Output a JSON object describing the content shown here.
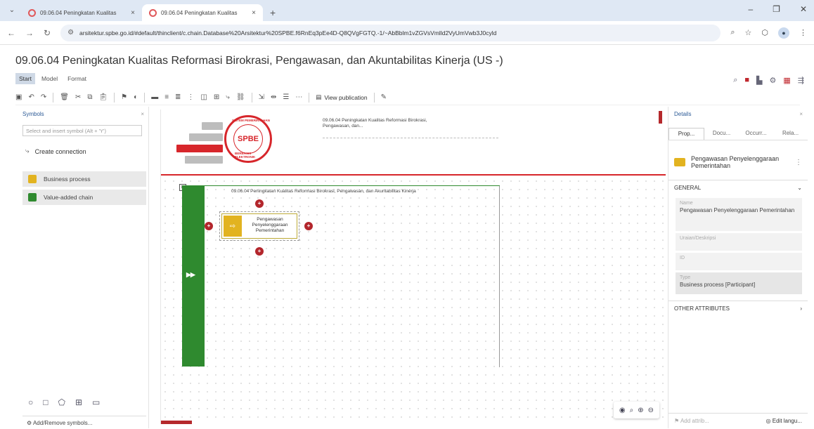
{
  "browser": {
    "tabs": [
      {
        "title": "09.06.04 Peningkatan Kualitas",
        "active": false
      },
      {
        "title": "09.06.04 Peningkatan Kualitas",
        "active": true
      }
    ],
    "url": "arsitektur.spbe.go.id/#default/thinclient/c.chain.Database%20Arsitektur%20SPBE.f6RnEq3pEe4D-Q8QVgFGTQ.-1/~AbBblm1vZGVsVmlld2VyUmVwb3J0cyld"
  },
  "app": {
    "title": "09.06.04 Peningkatan Kualitas Reformasi Birokrasi, Pengawasan, dan Akuntabilitas Kinerja  (US -)",
    "menu_tabs": [
      "Start",
      "Model",
      "Format"
    ],
    "toolbar_view_publication": "View publication"
  },
  "symbols_panel": {
    "title": "Symbols",
    "search_placeholder": "Select and insert symbol (Alt + 'Y')",
    "create_connection": "Create connection",
    "items": [
      {
        "label": "Business process",
        "color": "#e2b320"
      },
      {
        "label": "Value-added chain",
        "color": "#2f8a2f"
      }
    ],
    "add_remove": "Add/Remove symbols..."
  },
  "canvas": {
    "header_title": "09.06.04 Peningkatan Kualitas Reformasi Birokrasi, Pengawasan, dan...",
    "vac_title": "09.06.04 Peningkatan Kualitas Reformasi Birokrasi, Pengawasan, dan Akuntabilitas Kinerja",
    "process_label": "Pengawasan Penyelenggaraan Pemerintahan",
    "logo_text": "SPBE",
    "logo_seal_top": "SISTEM PEMERINTAHAN",
    "logo_seal_bottom": "BERBASIS ELEKTRONIK",
    "bar_colors": [
      "#bdbdbd",
      "#bdbdbd",
      "#d7262b",
      "#bdbdbd"
    ]
  },
  "details_panel": {
    "title": "Details",
    "tabs": [
      "Prop...",
      "Docu...",
      "Occurr...",
      "Rela..."
    ],
    "object_name": "Pengawasan Penyelenggaraan Pemerintahan",
    "general_label": "GENERAL",
    "fields": [
      {
        "label": "Name",
        "value": "Pengawasan Penyelenggaraan Pemerintahan"
      },
      {
        "label": "Uraian/Deskripsi",
        "value": ""
      },
      {
        "label": "ID",
        "value": ""
      },
      {
        "label": "Type",
        "value": "Business process [Participant]"
      }
    ],
    "other_attributes": "OTHER ATTRIBUTES",
    "add_attribute": "Add attrib...",
    "edit_language": "Edit langu..."
  }
}
